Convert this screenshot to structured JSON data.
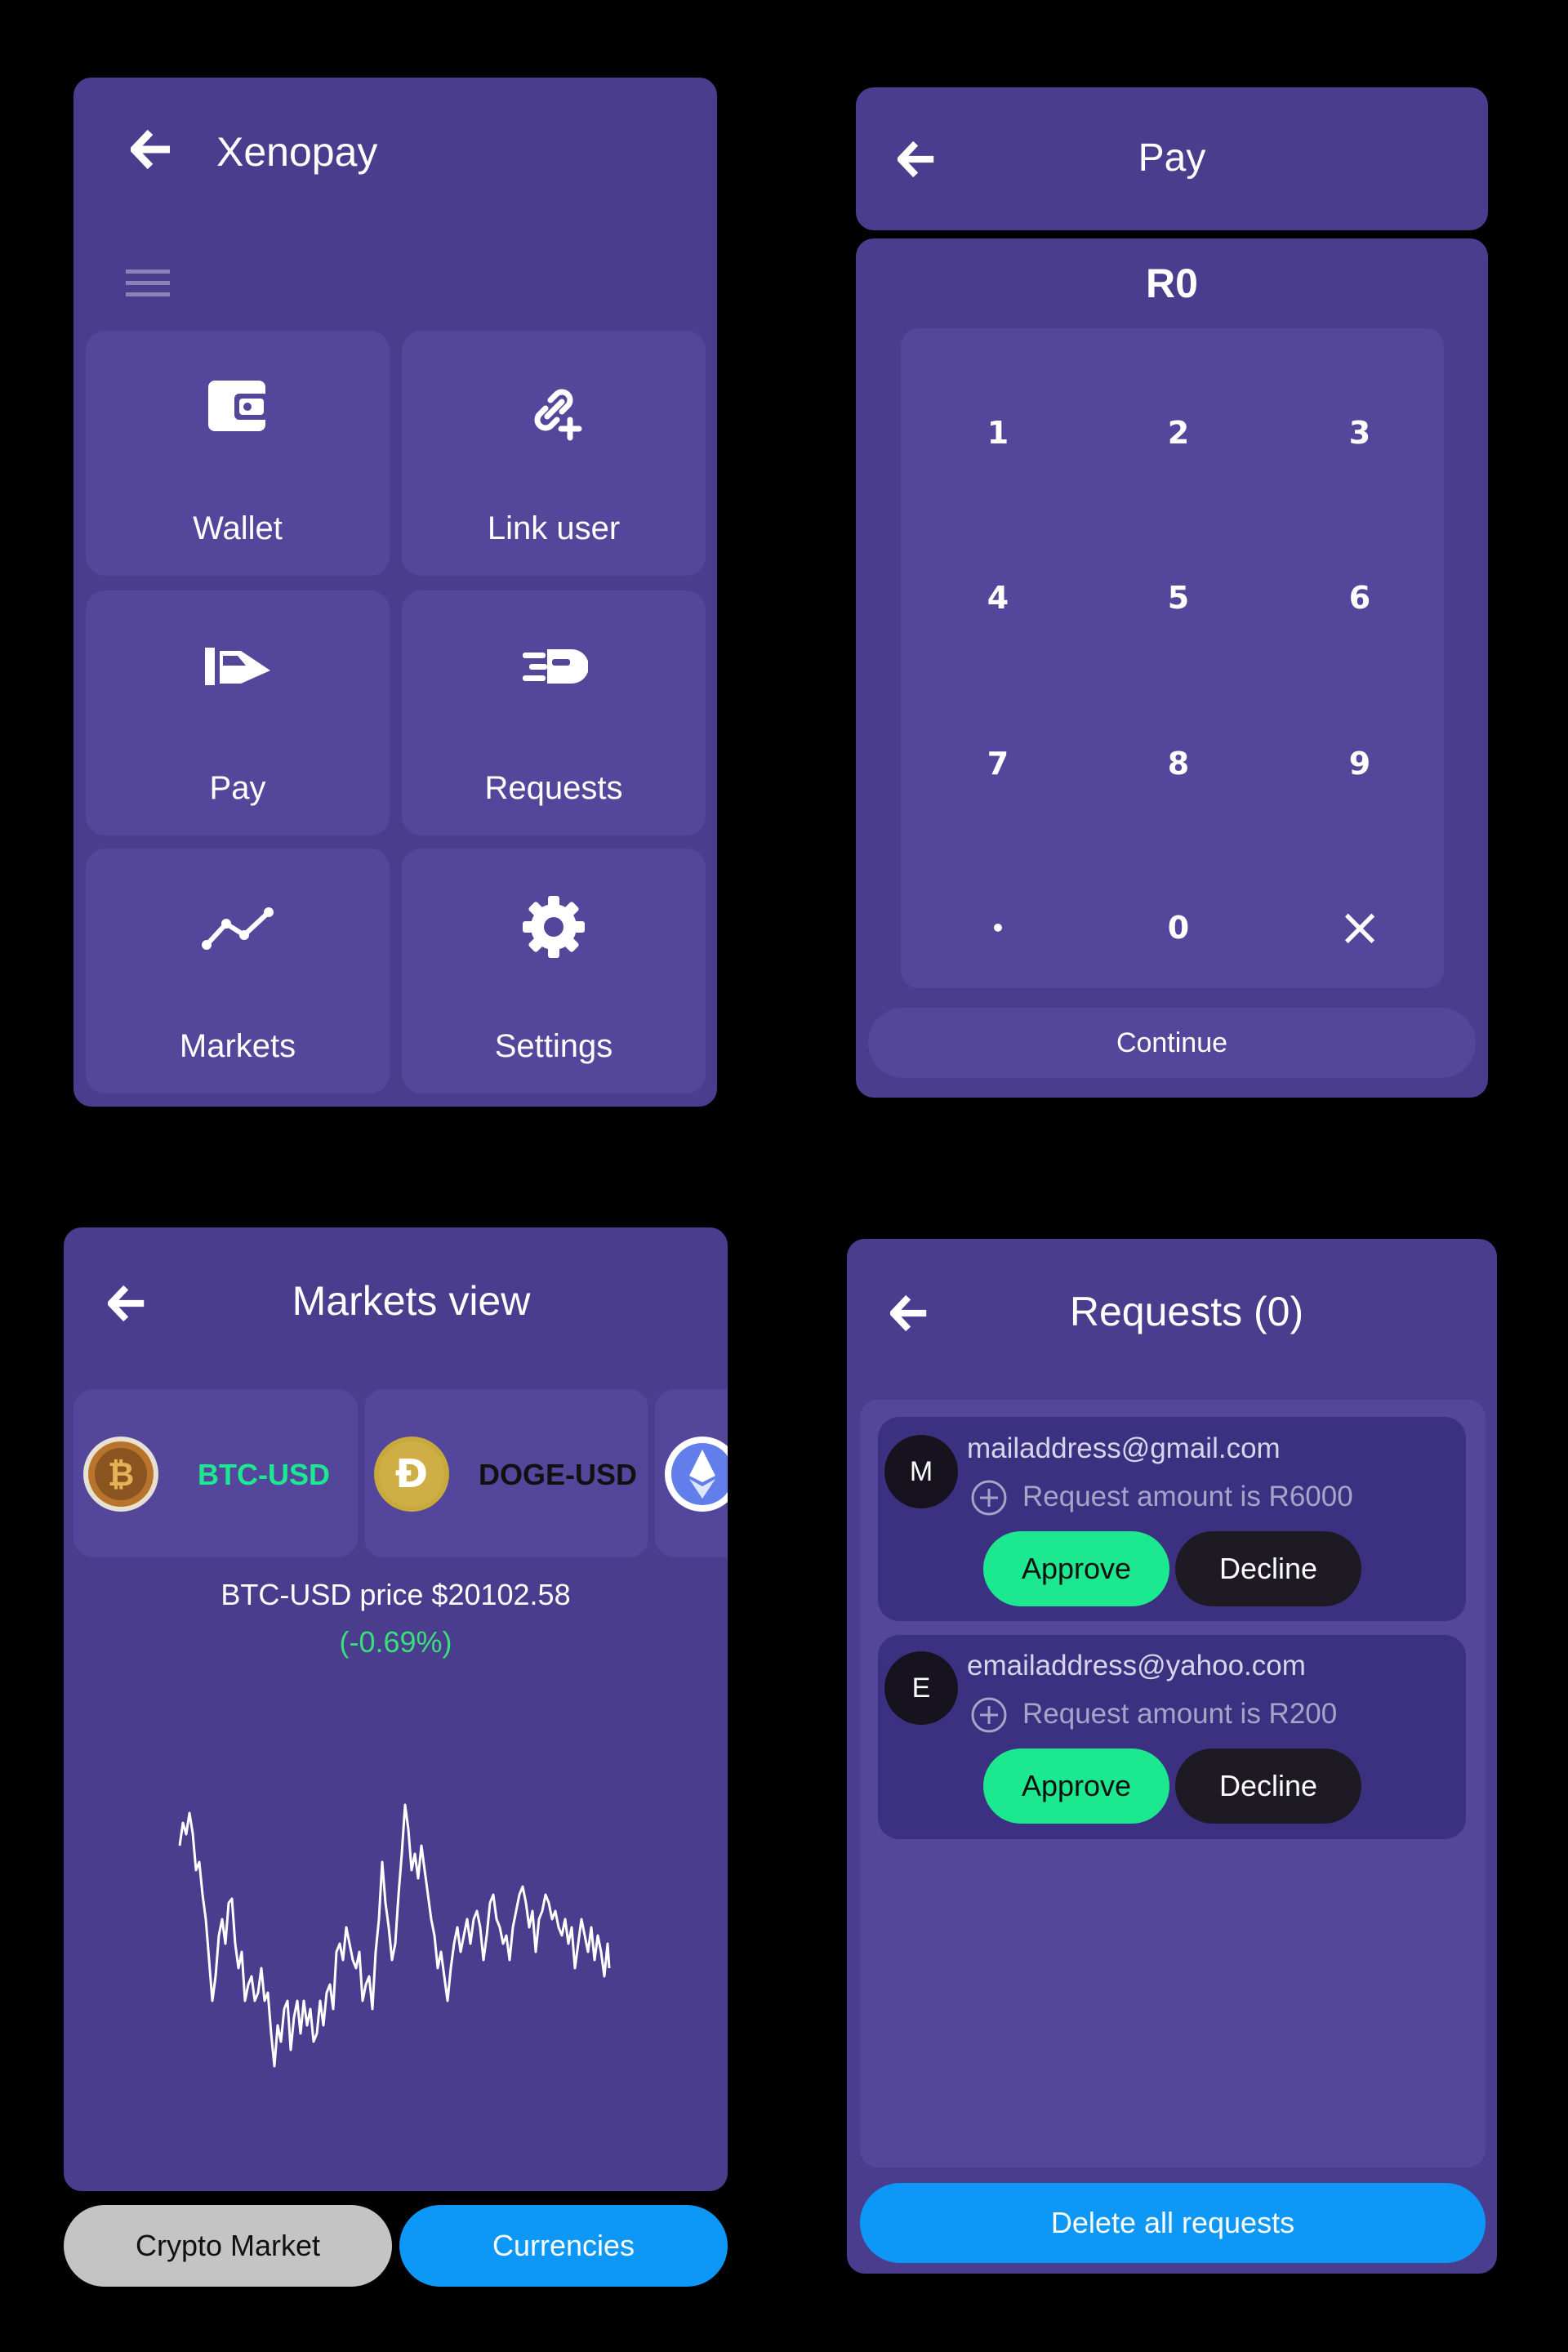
{
  "home": {
    "title": "Xenopay",
    "tiles": [
      {
        "label": "Wallet",
        "icon": "wallet-icon"
      },
      {
        "label": "Link user",
        "icon": "link-add-icon"
      },
      {
        "label": "Pay",
        "icon": "pay-icon"
      },
      {
        "label": "Requests",
        "icon": "requests-icon"
      },
      {
        "label": "Markets",
        "icon": "trend-icon"
      },
      {
        "label": "Settings",
        "icon": "gear-icon"
      }
    ]
  },
  "pay": {
    "title": "Pay",
    "amount": "R0",
    "keys": [
      "1",
      "2",
      "3",
      "4",
      "5",
      "6",
      "7",
      "8",
      "9",
      "•",
      "0",
      "×"
    ],
    "continue_label": "Continue"
  },
  "markets": {
    "title": "Markets view",
    "tickers": [
      {
        "label": "BTC-USD",
        "icon": "bitcoin-icon",
        "color": "#1be88f"
      },
      {
        "label": "DOGE-USD",
        "icon": "dogecoin-icon",
        "color": "#111111"
      },
      {
        "label": "",
        "icon": "ethereum-icon"
      }
    ],
    "price_text": "BTC-USD price $20102.58",
    "change_text": "(-0.69%)",
    "change_color": "#39e07a",
    "buttons": {
      "crypto_label": "Crypto Market",
      "currencies_label": "Currencies"
    }
  },
  "requests": {
    "title": "Requests (0)",
    "items": [
      {
        "initial": "M",
        "email": "mailaddress@gmail.com",
        "amount": "Request amount is R6000",
        "approve": "Approve",
        "decline": "Decline"
      },
      {
        "initial": "E",
        "email": "emailaddress@yahoo.com",
        "amount": "Request amount is R200",
        "approve": "Approve",
        "decline": "Decline"
      }
    ],
    "delete_label": "Delete all requests"
  },
  "colors": {
    "background": "#000000",
    "panel": "#4a3d8e",
    "tile": "#54479b",
    "approve": "#1be88f",
    "decline": "#1d1a24",
    "primary_blue": "#0d97f6",
    "secondary_gray": "#c4c4c4"
  }
}
